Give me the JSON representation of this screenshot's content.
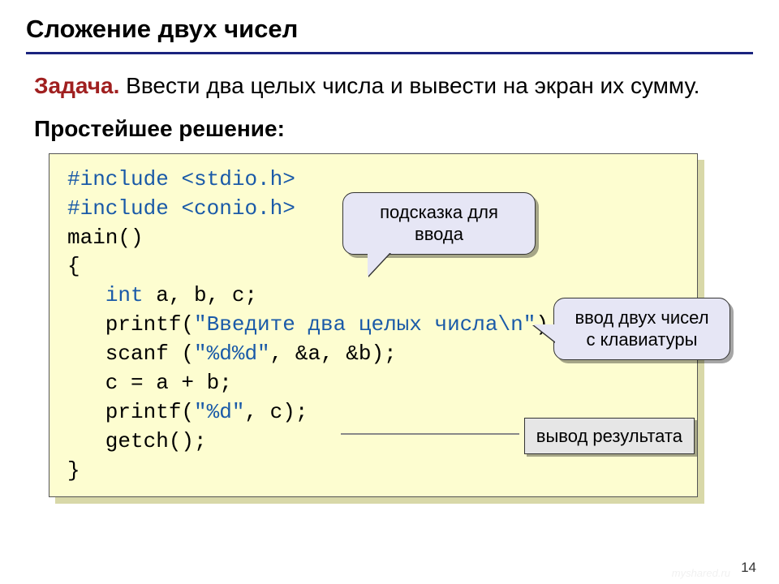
{
  "title": "Сложение двух чисел",
  "task_label": "Задача.",
  "task_text": " Ввести два целых числа и вывести на экран их сумму.",
  "subheading": "Простейшее решение:",
  "code": {
    "l1a": "#include ",
    "l1b": "<stdio.h>",
    "l2a": "#include ",
    "l2b": "<conio.h>",
    "l3": "main()",
    "l4": "{",
    "l5a": "   ",
    "l5b": "int",
    "l5c": " a, b, c;",
    "l6a": "   printf(",
    "l6b": "\"Введите два целых числа\\n\"",
    "l6c": ");",
    "l7a": "   scanf (",
    "l7b": "\"%d%d\"",
    "l7c": ", &a, &b);",
    "l8": "   c = a + b;",
    "l9a": "   printf(",
    "l9b": "\"%d\"",
    "l9c": ", c);",
    "l10": "   getch();",
    "l11": "}"
  },
  "callouts": {
    "hint": "подсказка для ввода",
    "input": "ввод двух чисел с клавиатуры",
    "output": "вывод результата"
  },
  "page_number": "14",
  "watermark": "myshared.ru"
}
